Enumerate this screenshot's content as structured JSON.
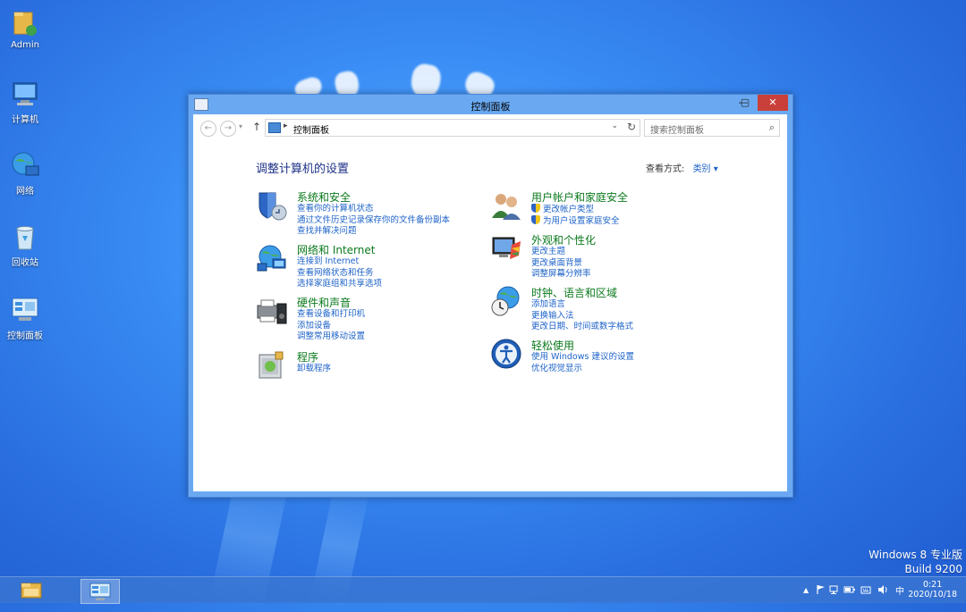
{
  "desktop": {
    "icons": [
      {
        "label": "Admin"
      },
      {
        "label": "计算机"
      },
      {
        "label": "网络"
      },
      {
        "label": "回收站"
      },
      {
        "label": "控制面板"
      }
    ]
  },
  "window": {
    "title": "控制面板",
    "controls": {
      "minimize": "—",
      "maximize": "▢",
      "close": "✕"
    }
  },
  "addressbar": {
    "back": "←",
    "forward": "→",
    "up": "↑",
    "separator": "▸",
    "breadcrumb": "控制面板",
    "dropdown": "⌄",
    "refresh": "↻",
    "search_placeholder": "搜索控制面板",
    "search_icon": "⌕"
  },
  "main": {
    "heading": "调整计算机的设置",
    "view_by_label": "查看方式:",
    "view_by_value": "类别 ▾",
    "categories_left": [
      {
        "title": "系统和安全",
        "icon": "shield-icon",
        "links": [
          "查看你的计算机状态",
          "通过文件历史记录保存你的文件备份副本",
          "查找并解决问题"
        ]
      },
      {
        "title": "网络和 Internet",
        "icon": "network-globe-icon",
        "links": [
          "连接到 Internet",
          "查看网络状态和任务",
          "选择家庭组和共享选项"
        ]
      },
      {
        "title": "硬件和声音",
        "icon": "printer-speaker-icon",
        "links": [
          "查看设备和打印机",
          "添加设备",
          "调整常用移动设置"
        ]
      },
      {
        "title": "程序",
        "icon": "programs-icon",
        "links": [
          "卸载程序"
        ]
      }
    ],
    "categories_right": [
      {
        "title": "用户帐户和家庭安全",
        "icon": "users-icon",
        "links": [
          "更改帐户类型",
          "为用户设置家庭安全"
        ],
        "shielded": [
          true,
          true
        ]
      },
      {
        "title": "外观和个性化",
        "icon": "appearance-icon",
        "links": [
          "更改主题",
          "更改桌面背景",
          "调整屏幕分辨率"
        ]
      },
      {
        "title": "时钟、语言和区域",
        "icon": "clock-globe-icon",
        "links": [
          "添加语言",
          "更换输入法",
          "更改日期、时间或数字格式"
        ]
      },
      {
        "title": "轻松使用",
        "icon": "ease-of-access-icon",
        "links": [
          "使用 Windows 建议的设置",
          "优化视觉显示"
        ]
      }
    ]
  },
  "taskbar": {
    "tray": {
      "expand": "▲",
      "ime": "中"
    },
    "clock_time": "0:21",
    "clock_date": "2020/10/18"
  },
  "watermark": {
    "line1": "Windows 8 专业版",
    "line2": "Build 9200"
  },
  "colors": {
    "category_title": "#0c7a1e",
    "link": "#1e63c8",
    "heading": "#1e3287",
    "close_button": "#c9403a"
  }
}
